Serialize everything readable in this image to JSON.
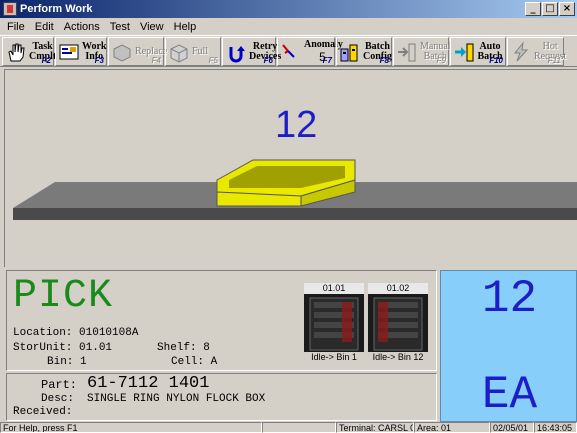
{
  "window": {
    "title": "Perform Work",
    "controls": [
      "_",
      "□",
      "×"
    ]
  },
  "menu": [
    "File",
    "Edit",
    "Actions",
    "Test",
    "View",
    "Help"
  ],
  "toolbar": [
    {
      "label": "Task Cmplt",
      "fkey": "F2",
      "icon": "hand-icon",
      "enabled": true
    },
    {
      "label": "Work Info",
      "fkey": "F3",
      "icon": "info-screen-icon",
      "enabled": true
    },
    {
      "label": "Replace",
      "fkey": "F4",
      "icon": "replace-icon",
      "enabled": false
    },
    {
      "label": "Full",
      "fkey": "F5",
      "icon": "full-box-icon",
      "enabled": false
    },
    {
      "label": "Retry Devices",
      "fkey": "F6",
      "icon": "retry-arrow-icon",
      "enabled": true
    },
    {
      "label": "Anomaly",
      "count": "5",
      "fkey": "F7",
      "icon": "anomaly-icon",
      "enabled": true
    },
    {
      "label": "Batch Config",
      "fkey": "F8",
      "icon": "batch-config-icon",
      "enabled": true
    },
    {
      "label": "Manual Batch",
      "fkey": "F9",
      "icon": "manual-batch-icon",
      "enabled": false
    },
    {
      "label": "Auto Batch",
      "fkey": "F10",
      "icon": "auto-batch-icon",
      "enabled": true
    },
    {
      "label": "Hot Request",
      "fkey": "F11",
      "icon": "hot-request-icon",
      "enabled": false
    }
  ],
  "scene": {
    "count": "12"
  },
  "pick": {
    "action": "PICK",
    "location_label": "Location:",
    "location": "01010108A",
    "storunit_label": "StorUnit:",
    "storunit": "01.01",
    "shelf_label": "Shelf:",
    "shelf": "8",
    "bin_label": "Bin:",
    "bin": "1",
    "cell_label": "Cell:",
    "cell": "A",
    "bins": [
      {
        "label": "01.01",
        "caption": "Idle-> Bin 1"
      },
      {
        "label": "01.02",
        "caption": "Idle-> Bin 12"
      }
    ]
  },
  "part": {
    "part_label": "Part:",
    "part": "61-7112 1401",
    "desc_label": "Desc:",
    "desc": "SINGLE RING NYLON FLOCK BOX",
    "received_label": "Received:",
    "received": ""
  },
  "quantity": {
    "value": "12",
    "unit": "EA"
  },
  "status": {
    "help": "For Help, press F1",
    "terminal": "Terminal: CARSL 01",
    "area": "Area: 01",
    "date": "02/05/01",
    "time": "16:43:05"
  },
  "colors": {
    "accent_blue": "#1e1ec8",
    "pick_green": "#1a8a1a",
    "qty_bg": "#87cefa",
    "tray": "#e8e800"
  }
}
